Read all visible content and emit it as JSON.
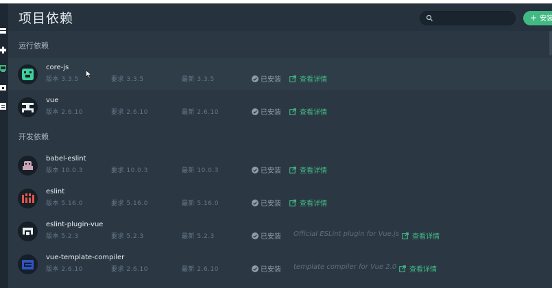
{
  "header": {
    "title": "项目依赖",
    "search": {
      "value": "",
      "placeholder": ""
    },
    "install_label": "安装依赖"
  },
  "sections": {
    "runtime": "运行依赖",
    "dev": "开发依赖"
  },
  "status_installed": "已安装",
  "details_label": "查看详情",
  "packages": [
    {
      "name": "core-js",
      "version": "版本 3.3.5",
      "wanted": "要求 3.3.5",
      "latest": "最新 3.3.5",
      "description": ""
    },
    {
      "name": "vue",
      "version": "版本 2.6.10",
      "wanted": "要求 2.6.10",
      "latest": "最新 2.6.10",
      "description": ""
    },
    {
      "name": "babel-eslint",
      "version": "版本 10.0.3",
      "wanted": "要求 10.0.3",
      "latest": "最新 10.0.3",
      "description": ""
    },
    {
      "name": "eslint",
      "version": "版本 5.16.0",
      "wanted": "要求 5.16.0",
      "latest": "最新 5.16.0",
      "description": ""
    },
    {
      "name": "eslint-plugin-vue",
      "version": "版本 5.2.3",
      "wanted": "要求 5.2.3",
      "latest": "最新 5.2.3",
      "description": "Official ESLint plugin for Vue.js"
    },
    {
      "name": "vue-template-compiler",
      "version": "版本 2.6.10",
      "wanted": "要求 2.6.10",
      "latest": "最新 2.6.10",
      "description": "template compiler for Vue 2.0"
    }
  ],
  "colors": {
    "accent": "#42b983",
    "background": "#2b3844",
    "header": "#26323e",
    "sidebar": "#1d2833"
  },
  "icons": [
    "search-icon",
    "plus-icon",
    "check-circle-icon",
    "external-link-icon",
    "dashboard-icon",
    "plugins-icon",
    "dependencies-icon",
    "configuration-icon",
    "tasks-icon"
  ]
}
